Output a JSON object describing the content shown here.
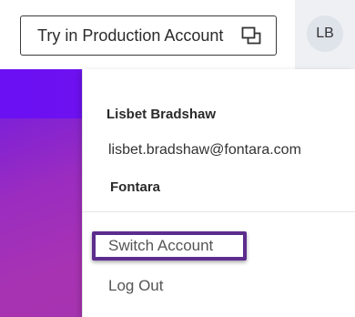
{
  "header": {
    "try_production_label": "Try in Production Account",
    "try_production_icon": "open-window-icon",
    "avatar_initials": "LB"
  },
  "account_menu": {
    "user_name": "Lisbet Bradshaw",
    "user_email": "lisbet.bradshaw@fontara.com",
    "organization": "Fontara",
    "items": [
      {
        "label": "Switch Account",
        "highlighted": true
      },
      {
        "label": "Log Out",
        "highlighted": false
      }
    ],
    "highlight_color": "#5d2d8e"
  },
  "colors": {
    "hero_gradient_start": "#6a18f0",
    "hero_gradient_end": "#a234ad",
    "avatar_bg": "#dfe3ea"
  }
}
